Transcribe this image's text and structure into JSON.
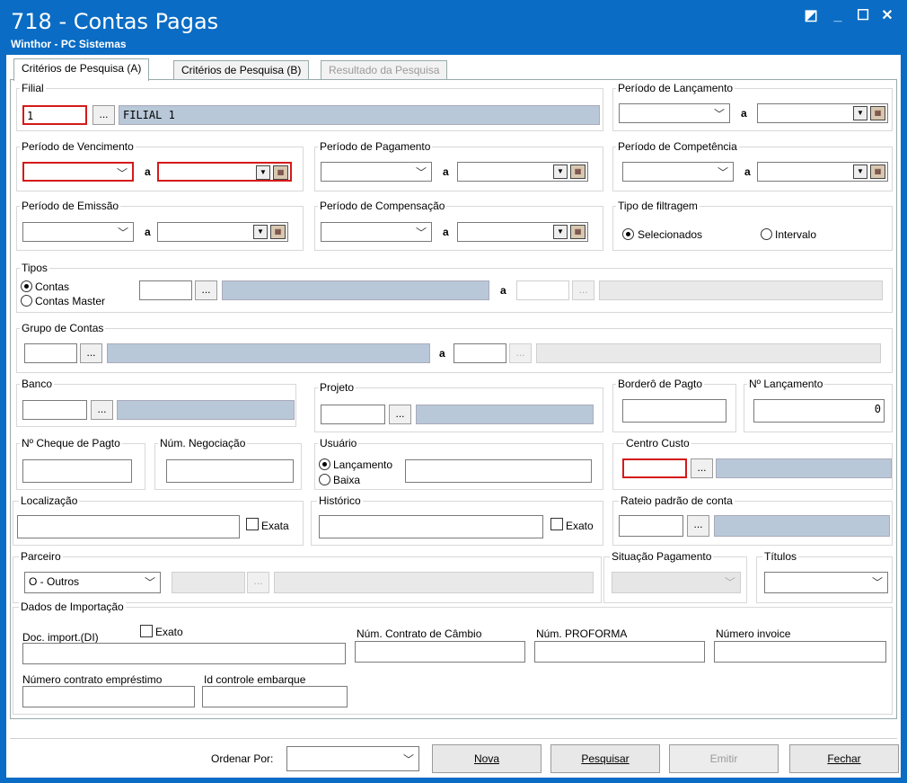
{
  "window": {
    "title": "718 - Contas Pagas",
    "subtitle": "Winthor - PC Sistemas"
  },
  "tabs": [
    {
      "label": "Critérios de Pesquisa (A)"
    },
    {
      "label": "Critérios de Pesquisa (B)"
    },
    {
      "label": "Resultado da Pesquisa"
    }
  ],
  "filial": {
    "label": "Filial",
    "code": "1",
    "desc": "FILIAL 1",
    "dots": "..."
  },
  "periodo_lancamento": {
    "label": "Período de Lançamento",
    "a": "a"
  },
  "periodo_vencimento": {
    "label": "Período de Vencimento",
    "a": "a"
  },
  "periodo_pagamento": {
    "label": "Período de Pagamento",
    "a": "a"
  },
  "periodo_competencia": {
    "label": "Período de Competência",
    "a": "a"
  },
  "periodo_emissao": {
    "label": "Período de Emissão",
    "a": "a"
  },
  "periodo_compensacao": {
    "label": "Período de Compensação",
    "a": "a"
  },
  "tipo_filtragem": {
    "label": "Tipo de filtragem",
    "opt1": "Selecionados",
    "opt2": "Intervalo"
  },
  "tipos": {
    "label": "Tipos",
    "opt1": "Contas",
    "opt2": "Contas Master",
    "a": "a"
  },
  "grupo_contas": {
    "label": "Grupo de Contas",
    "a": "a"
  },
  "banco": {
    "label": "Banco"
  },
  "projeto": {
    "label": "Projeto"
  },
  "bordero": {
    "label": "Borderô de Pagto"
  },
  "num_lancamento": {
    "label": "Nº Lançamento",
    "value": "0"
  },
  "cheque": {
    "label": "Nº Cheque de Pagto"
  },
  "negociacao": {
    "label": "Núm. Negociação"
  },
  "usuario": {
    "label": "Usuário",
    "opt1": "Lançamento",
    "opt2": "Baixa"
  },
  "centro_custo": {
    "label": "Centro Custo"
  },
  "localizacao": {
    "label": "Localização",
    "exata": "Exata"
  },
  "historico": {
    "label": "Histórico",
    "exato": "Exato"
  },
  "rateio": {
    "label": "Rateio padrão de conta"
  },
  "parceiro": {
    "label": "Parceiro",
    "value": "O - Outros"
  },
  "situacao": {
    "label": "Situação Pagamento"
  },
  "titulos": {
    "label": "Títulos"
  },
  "importacao": {
    "label": "Dados de Importação",
    "doc": "Doc. import.(DI)",
    "exato": "Exato",
    "contrato_cambio": "Núm. Contrato de Câmbio",
    "proforma": "Núm. PROFORMA",
    "invoice": "Número invoice",
    "contrato_emprestimo": "Número contrato empréstimo",
    "id_embarque": "Id controle embarque"
  },
  "footer": {
    "ordenar_label": "Ordenar Por:",
    "nova": "Nova",
    "pesquisar": "Pesquisar",
    "emitir": "Emitir",
    "fechar": "Fechar"
  },
  "colors": {
    "titlebar": "#0a6cc4",
    "required_border": "#d51a1a",
    "desc_bg": "#b8c8d8"
  }
}
